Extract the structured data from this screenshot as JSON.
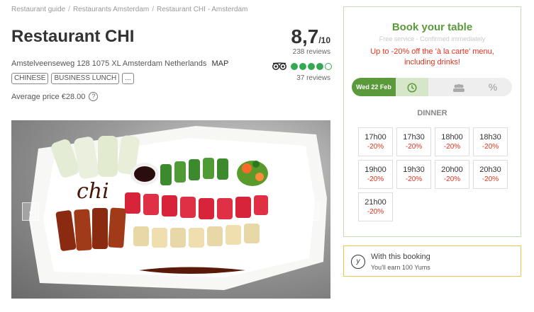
{
  "breadcrumb": [
    "Restaurant guide",
    "Restaurants Amsterdam",
    "Restaurant CHI - Amsterdam"
  ],
  "restaurant": {
    "name": "Restaurant CHI",
    "score": "8,7",
    "score_outof": "/10",
    "review_count": "238 reviews",
    "address": "Amstelveenseweg 128 1075 XL Amsterdam Netherlands",
    "map_label": "MAP",
    "tags": [
      "CHINESE",
      "BUSINESS LUNCH",
      "..."
    ],
    "average_price": "Average price €28.00",
    "help_icon": "?",
    "tripadvisor": {
      "rating": 4,
      "max": 5,
      "reviews": "37 reviews"
    }
  },
  "photo": {
    "prev_label": "‹",
    "next_label": "›",
    "plate_text": "chi"
  },
  "favorite_icon": "☆",
  "booking": {
    "title": "Book your table",
    "subtitle": "Free service - Confirmed immediately",
    "promo": "Up to -20% off the 'à la carte' menu, including drinks!",
    "tabs": {
      "date": "Wed 22 Feb",
      "time_icon": "clock-icon",
      "people_icon": "people-icon",
      "discount_label": "%"
    },
    "service": "DINNER",
    "slots": [
      {
        "time": "17h00",
        "discount": "-20%"
      },
      {
        "time": "17h30",
        "discount": "-20%"
      },
      {
        "time": "18h00",
        "discount": "-20%"
      },
      {
        "time": "18h30",
        "discount": "-20%"
      },
      {
        "time": "19h00",
        "discount": "-20%"
      },
      {
        "time": "19h30",
        "discount": "-20%"
      },
      {
        "time": "20h00",
        "discount": "-20%"
      },
      {
        "time": "20h30",
        "discount": "-20%"
      },
      {
        "time": "21h00",
        "discount": "-20%"
      }
    ]
  },
  "yums": {
    "icon_letter": "y",
    "line1": "With this booking",
    "line2": "You'll earn 100 Yums"
  },
  "colors": {
    "green": "#5a9a3a",
    "red": "#e8321e",
    "yellow_border": "#e8c84a"
  }
}
